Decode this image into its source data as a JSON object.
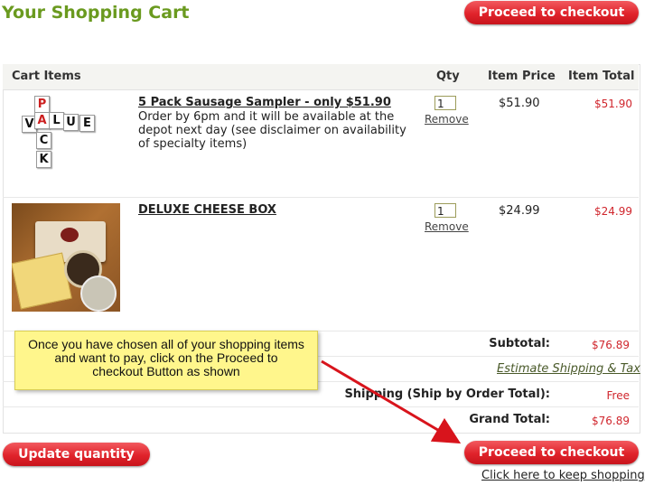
{
  "page": {
    "title": "Your Shopping Cart",
    "proceed_top_label": "Proceed to checkout",
    "proceed_bottom_label": "Proceed to checkout",
    "update_label": "Update quantity",
    "keep_shopping_label": "Click here to keep shopping"
  },
  "table": {
    "headers": {
      "items": "Cart Items",
      "qty": "Qty",
      "price": "Item Price",
      "total": "Item Total"
    }
  },
  "items": [
    {
      "name": "5 Pack Sausage Sampler - only $51.90",
      "desc_lines": [
        "Order by 6pm and it will be available at the",
        "depot next day (see disclaimer on availability",
        "of specialty items)"
      ],
      "qty": "1",
      "remove": "Remove",
      "price": "$51.90",
      "total": "$51.90",
      "image_tiles": {
        "vertical": [
          "P",
          "A",
          "C",
          "K"
        ],
        "horizontal": [
          "V",
          "A",
          "L",
          "U",
          "E"
        ]
      }
    },
    {
      "name": "DELUXE CHEESE BOX",
      "qty": "1",
      "remove": "Remove",
      "price": "$24.99",
      "total": "$24.99"
    }
  ],
  "summary": {
    "subtotal_label": "Subtotal:",
    "subtotal_value": "$76.89",
    "estimate_label": "Estimate Shipping & Tax",
    "shipping_label": "Shipping (Ship by Order Total):",
    "shipping_value": "Free",
    "grand_label": "Grand Total:",
    "grand_value": "$76.89"
  },
  "callout": {
    "lines": [
      "Once you have chosen all of your shopping items",
      "and want to pay, click on the Proceed to",
      "checkout Button as shown"
    ]
  },
  "colors": {
    "title_green": "#6a9a1f",
    "button_red": "#e0232b",
    "total_red": "#d0262d",
    "callout_yellow": "#fff68c",
    "arrow_red": "#d8141c"
  }
}
